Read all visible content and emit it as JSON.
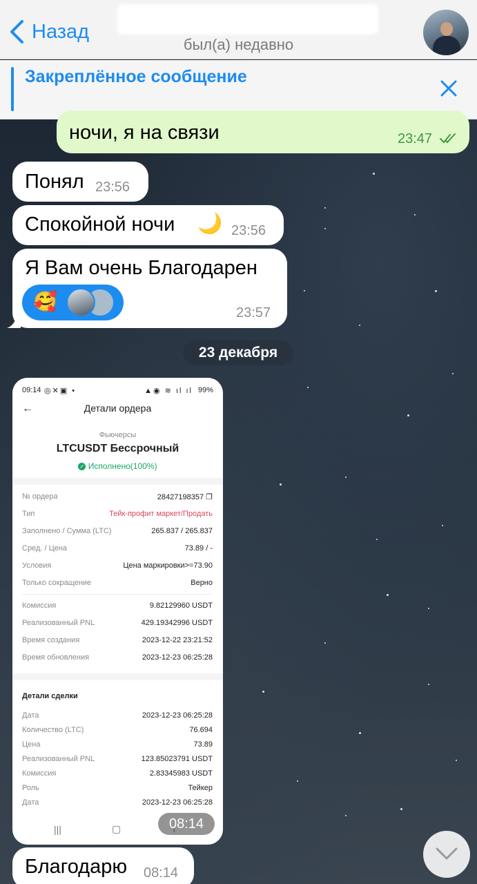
{
  "header": {
    "back_label": "Назад",
    "status": "был(а) недавно",
    "accent_color": "#1d8cf0"
  },
  "pinned": {
    "title": "Закреплённое сообщение"
  },
  "messages": [
    {
      "direction": "out",
      "text": "ночи, я на связи",
      "time": "23:47"
    },
    {
      "direction": "in",
      "text": "Понял",
      "time": "23:56"
    },
    {
      "direction": "in",
      "text": "Спокойной ночи",
      "emoji": "🌙",
      "time": "23:56"
    },
    {
      "direction": "in",
      "text": "Я Вам очень Благодарен",
      "reaction_emoji": "🥰",
      "time": "23:57"
    },
    {
      "direction": "in",
      "text": "Благодарю",
      "time": "08:14"
    }
  ],
  "date_separator": "23 декабря",
  "screenshot": {
    "time": "08:14",
    "status_time": "09:14",
    "battery": "99%",
    "title": "Детали ордера",
    "category": "Фьючерсы",
    "pair": "LTCUSDT Бессрочный",
    "state": "Исполнено(100%)",
    "order_rows": [
      {
        "k": "№ ордера",
        "v": "28427198357 ❐"
      },
      {
        "k": "Тип",
        "v": "Тейк-профит маркет/Продать"
      },
      {
        "k": "Заполнено / Сумма (LTC)",
        "v": "265.837 / 265.837"
      },
      {
        "k": "Сред. / Цена",
        "v": "73.89 / -"
      },
      {
        "k": "Условия",
        "v": "Цена маркировки>=73.90"
      },
      {
        "k": "Только сокращение",
        "v": "Верно"
      }
    ],
    "fee_rows": [
      {
        "k": "Комиссия",
        "v": "9.82129960 USDT"
      },
      {
        "k": "Реализованный PNL",
        "v": "429.19342996 USDT"
      },
      {
        "k": "Время создания",
        "v": "2023-12-22 23:21:52"
      },
      {
        "k": "Время обновления",
        "v": "2023-12-23 06:25:28"
      }
    ],
    "trade_title": "Детали сделки",
    "trade_rows": [
      {
        "k": "Дата",
        "v": "2023-12-23 06:25:28"
      },
      {
        "k": "Количество (LTC)",
        "v": "76.694"
      },
      {
        "k": "Цена",
        "v": "73.89"
      },
      {
        "k": "Реализованный PNL",
        "v": "123.85023791 USDT"
      },
      {
        "k": "Комиссия",
        "v": "2.83345983 USDT"
      },
      {
        "k": "Роль",
        "v": "Тейкер"
      },
      {
        "k": "Дата",
        "v": "2023-12-23 06:25:28"
      }
    ],
    "nav": [
      "|||",
      "▢",
      "‹"
    ]
  }
}
